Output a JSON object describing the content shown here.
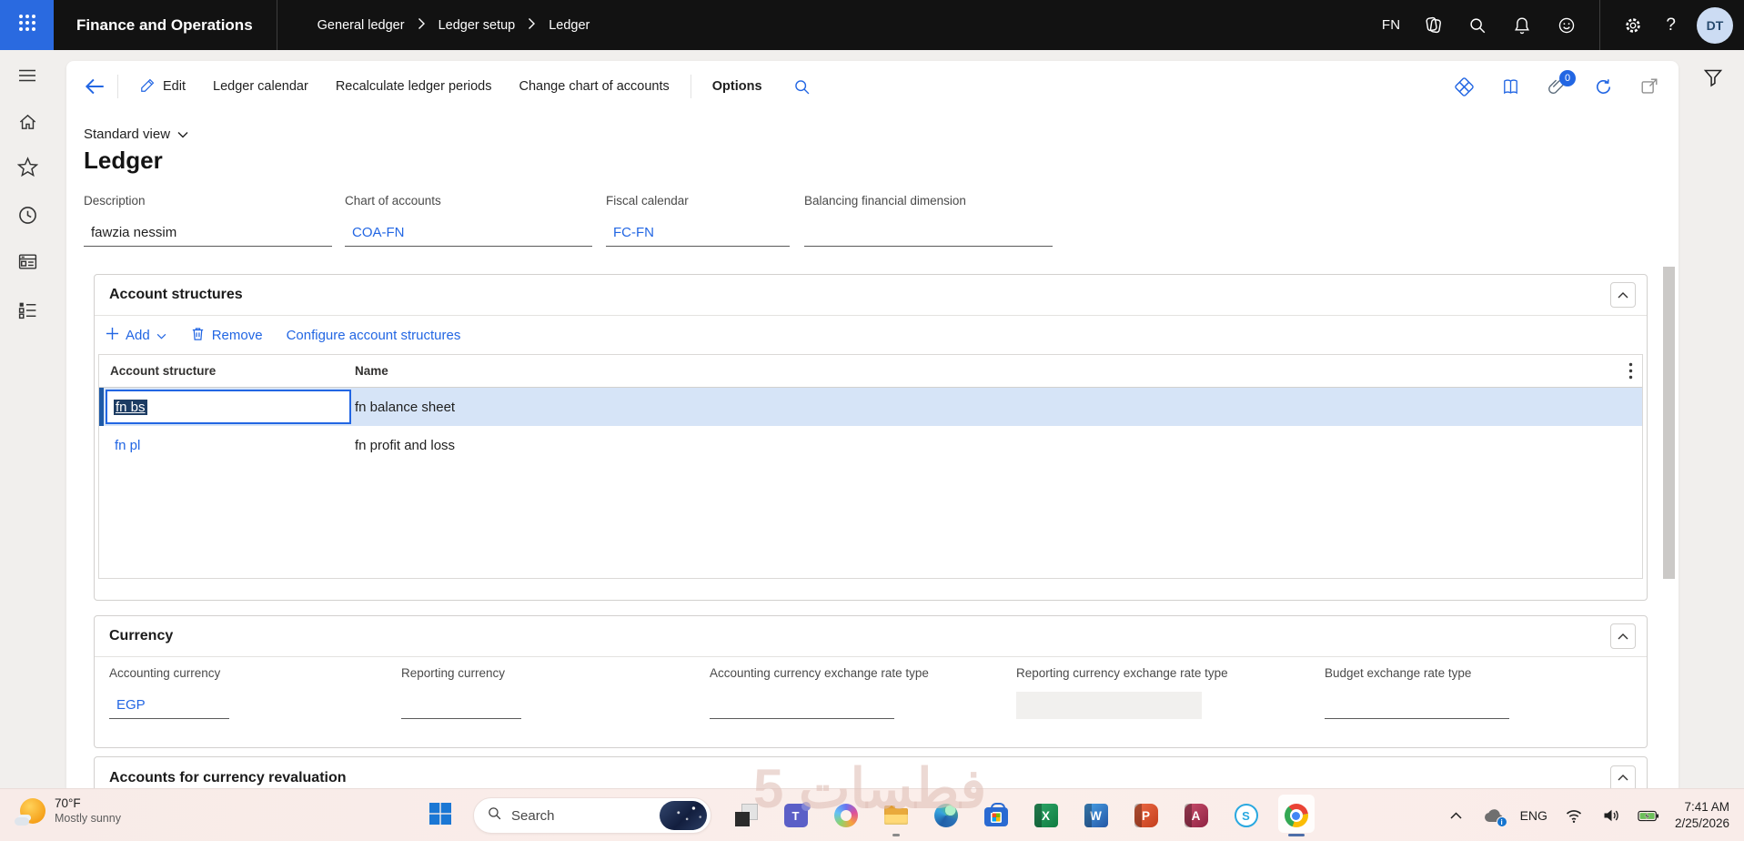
{
  "titlebar": {
    "app_title": "Finance and Operations",
    "breadcrumb": [
      "General ledger",
      "Ledger setup",
      "Ledger"
    ],
    "environment": "FN",
    "help_glyph": "?",
    "avatar_initials": "DT"
  },
  "action_bar": {
    "edit": "Edit",
    "ledger_calendar": "Ledger calendar",
    "recalculate": "Recalculate ledger periods",
    "change_coa": "Change chart of accounts",
    "options": "Options",
    "attachment_count": "0"
  },
  "page": {
    "view_selector": "Standard view",
    "title": "Ledger"
  },
  "header_fields": {
    "description": {
      "label": "Description",
      "value": "fawzia nessim"
    },
    "chart_of_accounts": {
      "label": "Chart of accounts",
      "value": "COA-FN"
    },
    "fiscal_calendar": {
      "label": "Fiscal calendar",
      "value": "FC-FN"
    },
    "balancing_dimension": {
      "label": "Balancing financial dimension",
      "value": ""
    }
  },
  "account_structures": {
    "title": "Account structures",
    "add": "Add",
    "remove": "Remove",
    "configure": "Configure account structures",
    "col_account_structure": "Account structure",
    "col_name": "Name",
    "rows": [
      {
        "structure": "fn bs",
        "name": "fn balance sheet"
      },
      {
        "structure": "fn pl",
        "name": "fn profit and loss"
      }
    ]
  },
  "currency": {
    "title": "Currency",
    "accounting": {
      "label": "Accounting currency",
      "value": "EGP"
    },
    "reporting": {
      "label": "Reporting currency",
      "value": ""
    },
    "acct_exchange": {
      "label": "Accounting currency exchange rate type",
      "value": ""
    },
    "rep_exchange": {
      "label": "Reporting currency exchange rate type",
      "value": ""
    },
    "budget_exchange": {
      "label": "Budget exchange rate type",
      "value": ""
    }
  },
  "revaluation": {
    "title": "Accounts for currency revaluation"
  },
  "taskbar": {
    "weather_temp": "70°F",
    "weather_desc": "Mostly sunny",
    "search_placeholder": "Search",
    "language": "ENG",
    "time": "7:41 AM",
    "date": "2/25/2026",
    "app_letters": {
      "teams": "T",
      "excel": "X",
      "word": "W",
      "powerpoint": "P",
      "access": "A",
      "skype": "S"
    }
  },
  "watermark": "فطسات 5",
  "colors": {
    "accent_blue": "#2266E3",
    "selection_navy": "#1d3c63",
    "selected_row": "#d6e4f7"
  }
}
